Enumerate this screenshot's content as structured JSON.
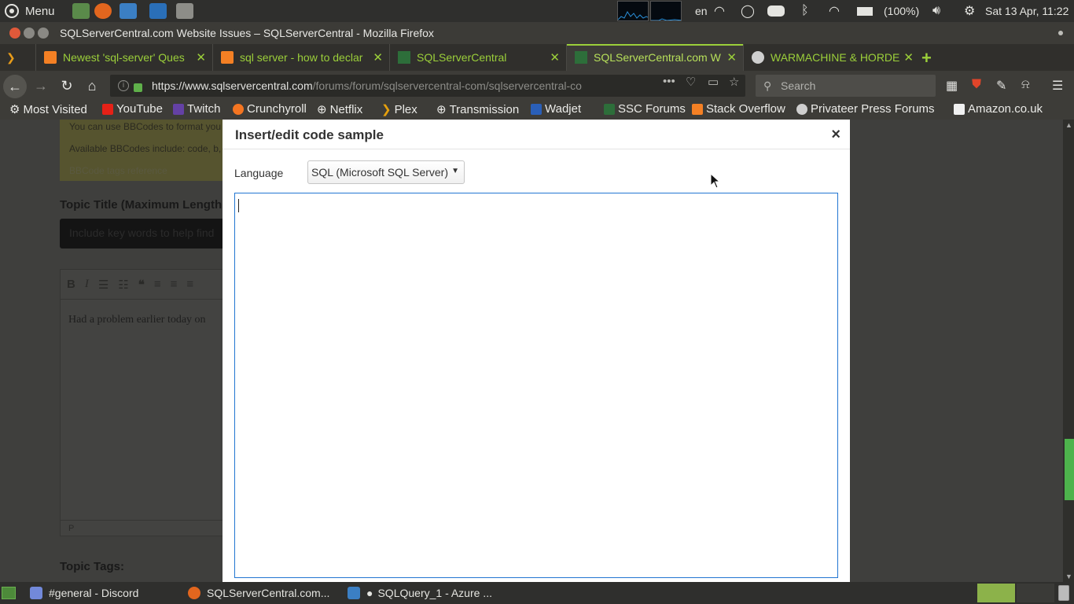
{
  "system": {
    "menu_label": "Menu",
    "keyboard_layout": "en",
    "battery": "(100%)",
    "clock": "Sat 13 Apr, 11:22"
  },
  "window": {
    "title": "SQLServerCentral.com Website Issues – SQLServerCentral - Mozilla Firefox"
  },
  "tabs": [
    {
      "label": "Newest 'sql-server' Ques",
      "icon": "stackoverflow-icon"
    },
    {
      "label": "sql server - how to declar",
      "icon": "stackoverflow-icon"
    },
    {
      "label": "SQLServerCentral",
      "icon": "ssc-icon"
    },
    {
      "label": "SQLServerCentral.com W",
      "icon": "ssc-icon",
      "active": true
    },
    {
      "label": "WARMACHINE & HORDE",
      "icon": "privateer-icon"
    }
  ],
  "nav": {
    "url_domain": "https://www.sqlservercentral.com",
    "url_path": "/forums/forum/sqlservercentral-com/sqlservercentral-co",
    "search_placeholder": "Search"
  },
  "bookmarks": [
    {
      "label": "Most Visited",
      "icon": "gear-icon"
    },
    {
      "label": "YouTube",
      "icon": "youtube-icon"
    },
    {
      "label": "Twitch",
      "icon": "twitch-icon"
    },
    {
      "label": "Crunchyroll",
      "icon": "crunchyroll-icon"
    },
    {
      "label": "Netflix",
      "icon": "globe-icon"
    },
    {
      "label": "Plex",
      "icon": "plex-icon"
    },
    {
      "label": "Transmission",
      "icon": "globe-icon"
    },
    {
      "label": "Wadjet",
      "icon": "wadjet-icon"
    },
    {
      "label": "SSC Forums",
      "icon": "ssc-icon"
    },
    {
      "label": "Stack Overflow",
      "icon": "stackoverflow-icon"
    },
    {
      "label": "Privateer Press Forums",
      "icon": "privateer-icon"
    },
    {
      "label": "Amazon.co.uk",
      "icon": "amazon-icon"
    }
  ],
  "page": {
    "bbcode_line1": "You can use BBCodes to format you",
    "bbcode_line2": "Available BBCodes include: code, b, i",
    "bbcode_ref": "BBCode tags reference",
    "topic_title_label": "Topic Title (Maximum Length",
    "topic_title_placeholder": "Include key words to help find",
    "editor_text": "Had a problem earlier today on",
    "editor_status": "P",
    "topic_tags_label": "Topic Tags:"
  },
  "dialog": {
    "title": "Insert/edit code sample",
    "close": "×",
    "language_label": "Language",
    "language_value": "SQL (Microsoft SQL Server)",
    "code_value": ""
  },
  "taskbar": [
    {
      "label": "#general - Discord",
      "icon": "discord-icon"
    },
    {
      "label": "SQLServerCentral.com...",
      "icon": "firefox-icon"
    },
    {
      "label": "SQLQuery_1 - Azure ...",
      "icon": "azure-icon"
    }
  ],
  "colors": {
    "tab_accent": "#9bcf3a",
    "focus_border": "#2276d2",
    "scroll_thumb": "#4db34c"
  }
}
